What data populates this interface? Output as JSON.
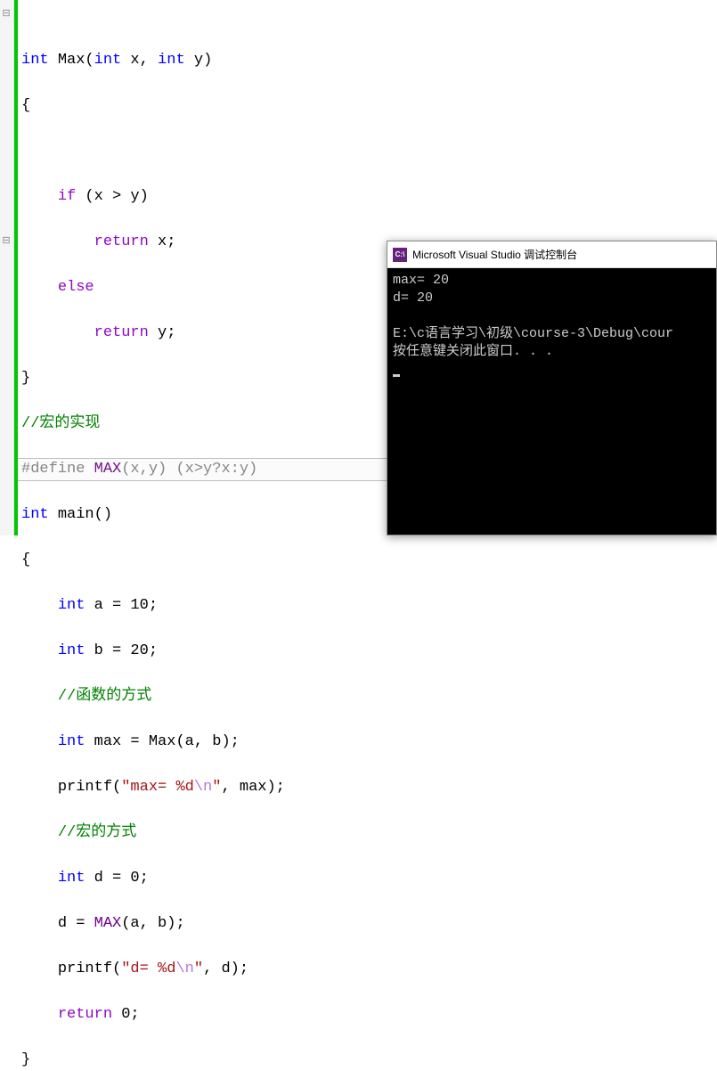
{
  "code": {
    "l1": {
      "kw": "int",
      "fn": "Max",
      "sig_open": "(",
      "p1": "int",
      "a1": " x",
      "comma": ", ",
      "p2": "int",
      "a2": " y",
      "sig_close": ")"
    },
    "l2": "{",
    "l4": {
      "kw": "if",
      "open": " (x > y)"
    },
    "l5": {
      "kw": "return",
      "rest": " x;"
    },
    "l6": {
      "kw": "else"
    },
    "l7": {
      "kw": "return",
      "rest": " y;"
    },
    "l8": "}",
    "l9": "//宏的实现",
    "l10": {
      "pre": "#define",
      "mac": " MAX",
      "body": "(x,y) (x>y?x:y)"
    },
    "l11": {
      "kw": "int",
      "fn": "main",
      "sig": "()"
    },
    "l12": "{",
    "l13": {
      "kw": "int",
      "rest": " a = 10;"
    },
    "l14": {
      "kw": "int",
      "rest": " b = 20;"
    },
    "l15": "//函数的方式",
    "l16": {
      "kw": "int",
      "rest": " max = Max(a, b);"
    },
    "l17": {
      "fn": "printf",
      "open": "(",
      "s1": "\"max= %d",
      "esc": "\\n",
      "s2": "\"",
      "rest": ", max);"
    },
    "l18": "//宏的方式",
    "l19": {
      "kw": "int",
      "rest": " d = 0;"
    },
    "l20": {
      "lhs": "d = ",
      "mac": "MAX",
      "rest": "(a, b);"
    },
    "l21": {
      "fn": "printf",
      "open": "(",
      "s1": "\"d= %d",
      "esc": "\\n",
      "s2": "\"",
      "rest": ", d);"
    },
    "l22": {
      "kw": "return",
      "rest": " 0;"
    },
    "l23": "}"
  },
  "console": {
    "title": "Microsoft Visual Studio 调试控制台",
    "icon_text": "C:\\",
    "lines": {
      "out1": "max= 20",
      "out2": "d= 20",
      "blank": "",
      "path": "E:\\c语言学习\\初级\\course-3\\Debug\\cour",
      "prompt": "按任意键关闭此窗口. . ."
    }
  }
}
